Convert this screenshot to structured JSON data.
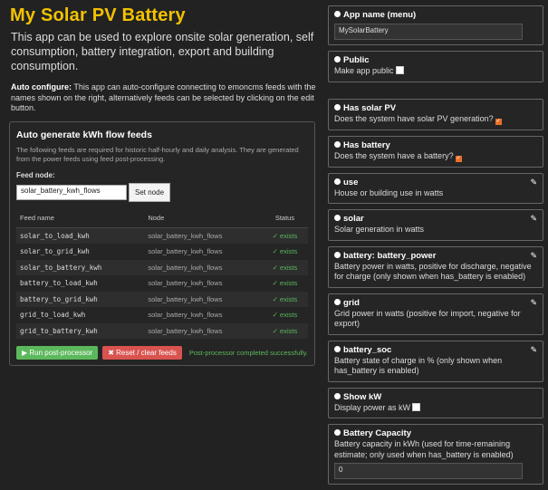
{
  "title": "My Solar PV Battery",
  "intro": "This app can be used to explore onsite solar generation, self consumption, battery integration, export and building consumption.",
  "auto_configure": {
    "label": "Auto configure:",
    "text": " This app can auto-configure connecting to emoncms feeds with the names shown on the right, alternatively feeds can be selected by clicking on the edit button."
  },
  "panel": {
    "title": "Auto generate kWh flow feeds",
    "desc": "The following feeds are required for historic half-hourly and daily analysis. They are generated from the power feeds using feed post-processing.",
    "feed_node_label": "Feed node:",
    "feed_node_value": "solar_battery_kwh_flows",
    "set_node_label": "Set node",
    "columns": [
      "Feed name",
      "Node",
      "Status"
    ],
    "rows": [
      {
        "feed": "solar_to_load_kwh",
        "node": "solar_battery_kwh_flows",
        "status": "✓ exists"
      },
      {
        "feed": "solar_to_grid_kwh",
        "node": "solar_battery_kwh_flows",
        "status": "✓ exists"
      },
      {
        "feed": "solar_to_battery_kwh",
        "node": "solar_battery_kwh_flows",
        "status": "✓ exists"
      },
      {
        "feed": "battery_to_load_kwh",
        "node": "solar_battery_kwh_flows",
        "status": "✓ exists"
      },
      {
        "feed": "battery_to_grid_kwh",
        "node": "solar_battery_kwh_flows",
        "status": "✓ exists"
      },
      {
        "feed": "grid_to_load_kwh",
        "node": "solar_battery_kwh_flows",
        "status": "✓ exists"
      },
      {
        "feed": "grid_to_battery_kwh",
        "node": "solar_battery_kwh_flows",
        "status": "✓ exists"
      }
    ],
    "run_label": "▶ Run post-processor",
    "reset_label": "✖ Reset / clear feeds",
    "message": "Post-processor completed successfully."
  },
  "config": {
    "app_name": {
      "title": "App name (menu)",
      "value": "MySolarBattery"
    },
    "public": {
      "title": "Public",
      "desc": "Make app public",
      "checked": false
    },
    "has_solar": {
      "title": "Has solar PV",
      "desc": "Does the system have solar PV generation?",
      "checked": true
    },
    "has_battery": {
      "title": "Has battery",
      "desc": "Does the system have a battery?",
      "checked": true
    },
    "use": {
      "title": "use",
      "desc": "House or building use in watts"
    },
    "solar": {
      "title": "solar",
      "desc": "Solar generation in watts"
    },
    "battery_power": {
      "title": "battery: battery_power",
      "desc": "Battery power in watts, positive for discharge, negative for charge (only shown when has_battery is enabled)"
    },
    "grid": {
      "title": "grid",
      "desc": "Grid power in watts (positive for import, negative for export)"
    },
    "battery_soc": {
      "title": "battery_soc",
      "desc": "Battery state of charge in % (only shown when has_battery is enabled)"
    },
    "show_kw": {
      "title": "Show kW",
      "desc": "Display power as kW",
      "checked": false
    },
    "battery_capacity": {
      "title": "Battery Capacity",
      "desc": "Battery capacity in kWh (used for time-remaining estimate; only used when has_battery is enabled)",
      "value": "0"
    }
  },
  "icons": {
    "edit": "pencil-icon",
    "bullet": "dot-icon",
    "checkbox_checked": "check-icon"
  }
}
